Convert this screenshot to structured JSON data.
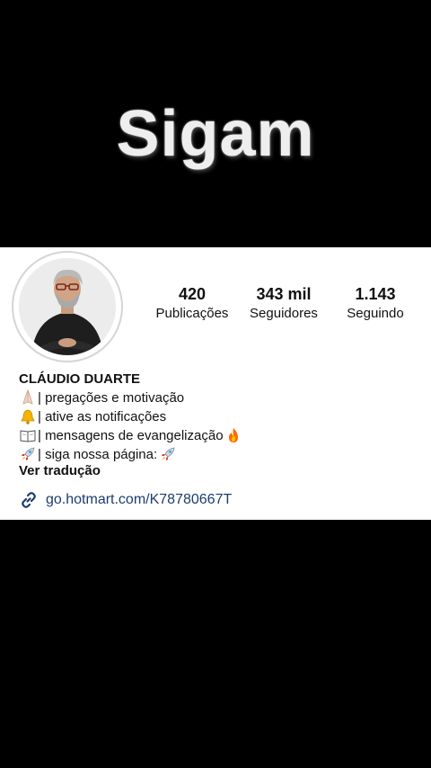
{
  "overlay": {
    "title": "Sigam"
  },
  "profile": {
    "stats": [
      {
        "value": "420",
        "label": "Publicações"
      },
      {
        "value": "343 mil",
        "label": "Seguidores"
      },
      {
        "value": "1.143",
        "label": "Seguindo"
      }
    ],
    "name": "CLÁUDIO DUARTE",
    "bio": [
      {
        "icon": "praying-hands-icon",
        "text": "| pregações e motivação"
      },
      {
        "icon": "bell-icon",
        "text": "| ative as notificações"
      },
      {
        "icon": "open-book-icon",
        "text": "| mensagens de evangelização",
        "trail_icon": "fire-icon"
      },
      {
        "icon": "rocket-icon",
        "text": "| siga nossa página: ",
        "trail_icon": "rocket-icon"
      }
    ],
    "translate_label": "Ver tradução",
    "link_text": "go.hotmart.com/K78780667T",
    "colors": {
      "link": "#1c3d6e",
      "card_bg": "#ffffff",
      "page_bg": "#000000"
    }
  }
}
